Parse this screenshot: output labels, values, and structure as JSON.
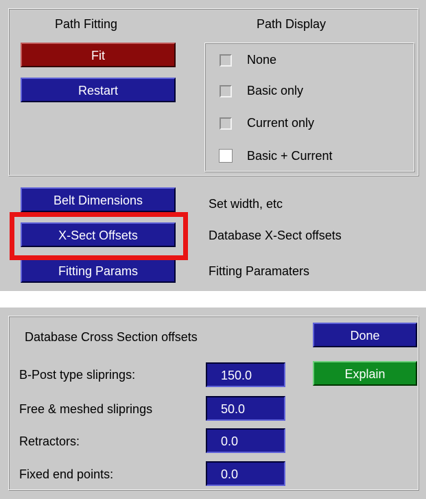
{
  "top_panel": {
    "path_fitting": {
      "heading": "Path Fitting",
      "fit_label": "Fit",
      "restart_label": "Restart"
    },
    "path_display": {
      "heading": "Path Display",
      "options": [
        {
          "label": "None",
          "checked": false
        },
        {
          "label": "Basic only",
          "checked": false
        },
        {
          "label": "Current only",
          "checked": false
        },
        {
          "label": "Basic + Current",
          "checked": true
        }
      ]
    },
    "actions": [
      {
        "button": "Belt Dimensions",
        "description": "Set width, etc"
      },
      {
        "button": "X-Sect Offsets",
        "description": "Database X-Sect offsets"
      },
      {
        "button": "Fitting Params",
        "description": "Fitting Paramaters"
      }
    ],
    "highlight_color": "#e81414"
  },
  "bottom_panel": {
    "title": "Database Cross Section offsets",
    "done_label": "Done",
    "explain_label": "Explain",
    "fields": [
      {
        "label": "B-Post type sliprings:",
        "value": "150.0"
      },
      {
        "label": "Free & meshed sliprings",
        "value": "50.0"
      },
      {
        "label": "Retractors:",
        "value": "0.0"
      },
      {
        "label": "Fixed end points:",
        "value": "0.0"
      }
    ]
  }
}
